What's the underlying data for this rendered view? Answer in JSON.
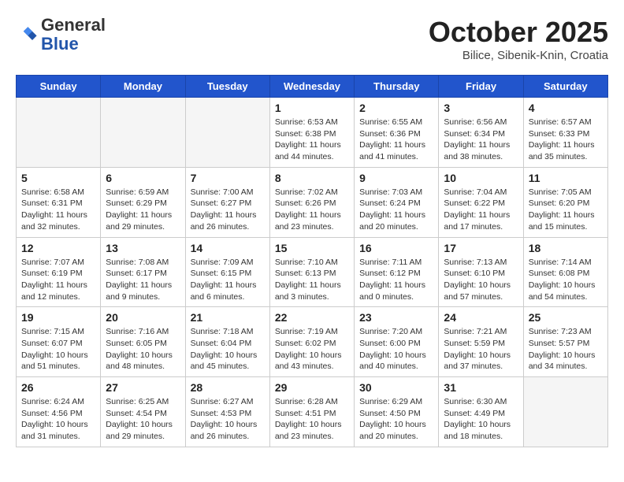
{
  "logo": {
    "general": "General",
    "blue": "Blue"
  },
  "header": {
    "month": "October 2025",
    "location": "Bilice, Sibenik-Knin, Croatia"
  },
  "weekdays": [
    "Sunday",
    "Monday",
    "Tuesday",
    "Wednesday",
    "Thursday",
    "Friday",
    "Saturday"
  ],
  "weeks": [
    [
      {
        "day": "",
        "info": ""
      },
      {
        "day": "",
        "info": ""
      },
      {
        "day": "",
        "info": ""
      },
      {
        "day": "1",
        "info": "Sunrise: 6:53 AM\nSunset: 6:38 PM\nDaylight: 11 hours and 44 minutes."
      },
      {
        "day": "2",
        "info": "Sunrise: 6:55 AM\nSunset: 6:36 PM\nDaylight: 11 hours and 41 minutes."
      },
      {
        "day": "3",
        "info": "Sunrise: 6:56 AM\nSunset: 6:34 PM\nDaylight: 11 hours and 38 minutes."
      },
      {
        "day": "4",
        "info": "Sunrise: 6:57 AM\nSunset: 6:33 PM\nDaylight: 11 hours and 35 minutes."
      }
    ],
    [
      {
        "day": "5",
        "info": "Sunrise: 6:58 AM\nSunset: 6:31 PM\nDaylight: 11 hours and 32 minutes."
      },
      {
        "day": "6",
        "info": "Sunrise: 6:59 AM\nSunset: 6:29 PM\nDaylight: 11 hours and 29 minutes."
      },
      {
        "day": "7",
        "info": "Sunrise: 7:00 AM\nSunset: 6:27 PM\nDaylight: 11 hours and 26 minutes."
      },
      {
        "day": "8",
        "info": "Sunrise: 7:02 AM\nSunset: 6:26 PM\nDaylight: 11 hours and 23 minutes."
      },
      {
        "day": "9",
        "info": "Sunrise: 7:03 AM\nSunset: 6:24 PM\nDaylight: 11 hours and 20 minutes."
      },
      {
        "day": "10",
        "info": "Sunrise: 7:04 AM\nSunset: 6:22 PM\nDaylight: 11 hours and 17 minutes."
      },
      {
        "day": "11",
        "info": "Sunrise: 7:05 AM\nSunset: 6:20 PM\nDaylight: 11 hours and 15 minutes."
      }
    ],
    [
      {
        "day": "12",
        "info": "Sunrise: 7:07 AM\nSunset: 6:19 PM\nDaylight: 11 hours and 12 minutes."
      },
      {
        "day": "13",
        "info": "Sunrise: 7:08 AM\nSunset: 6:17 PM\nDaylight: 11 hours and 9 minutes."
      },
      {
        "day": "14",
        "info": "Sunrise: 7:09 AM\nSunset: 6:15 PM\nDaylight: 11 hours and 6 minutes."
      },
      {
        "day": "15",
        "info": "Sunrise: 7:10 AM\nSunset: 6:13 PM\nDaylight: 11 hours and 3 minutes."
      },
      {
        "day": "16",
        "info": "Sunrise: 7:11 AM\nSunset: 6:12 PM\nDaylight: 11 hours and 0 minutes."
      },
      {
        "day": "17",
        "info": "Sunrise: 7:13 AM\nSunset: 6:10 PM\nDaylight: 10 hours and 57 minutes."
      },
      {
        "day": "18",
        "info": "Sunrise: 7:14 AM\nSunset: 6:08 PM\nDaylight: 10 hours and 54 minutes."
      }
    ],
    [
      {
        "day": "19",
        "info": "Sunrise: 7:15 AM\nSunset: 6:07 PM\nDaylight: 10 hours and 51 minutes."
      },
      {
        "day": "20",
        "info": "Sunrise: 7:16 AM\nSunset: 6:05 PM\nDaylight: 10 hours and 48 minutes."
      },
      {
        "day": "21",
        "info": "Sunrise: 7:18 AM\nSunset: 6:04 PM\nDaylight: 10 hours and 45 minutes."
      },
      {
        "day": "22",
        "info": "Sunrise: 7:19 AM\nSunset: 6:02 PM\nDaylight: 10 hours and 43 minutes."
      },
      {
        "day": "23",
        "info": "Sunrise: 7:20 AM\nSunset: 6:00 PM\nDaylight: 10 hours and 40 minutes."
      },
      {
        "day": "24",
        "info": "Sunrise: 7:21 AM\nSunset: 5:59 PM\nDaylight: 10 hours and 37 minutes."
      },
      {
        "day": "25",
        "info": "Sunrise: 7:23 AM\nSunset: 5:57 PM\nDaylight: 10 hours and 34 minutes."
      }
    ],
    [
      {
        "day": "26",
        "info": "Sunrise: 6:24 AM\nSunset: 4:56 PM\nDaylight: 10 hours and 31 minutes."
      },
      {
        "day": "27",
        "info": "Sunrise: 6:25 AM\nSunset: 4:54 PM\nDaylight: 10 hours and 29 minutes."
      },
      {
        "day": "28",
        "info": "Sunrise: 6:27 AM\nSunset: 4:53 PM\nDaylight: 10 hours and 26 minutes."
      },
      {
        "day": "29",
        "info": "Sunrise: 6:28 AM\nSunset: 4:51 PM\nDaylight: 10 hours and 23 minutes."
      },
      {
        "day": "30",
        "info": "Sunrise: 6:29 AM\nSunset: 4:50 PM\nDaylight: 10 hours and 20 minutes."
      },
      {
        "day": "31",
        "info": "Sunrise: 6:30 AM\nSunset: 4:49 PM\nDaylight: 10 hours and 18 minutes."
      },
      {
        "day": "",
        "info": ""
      }
    ]
  ]
}
